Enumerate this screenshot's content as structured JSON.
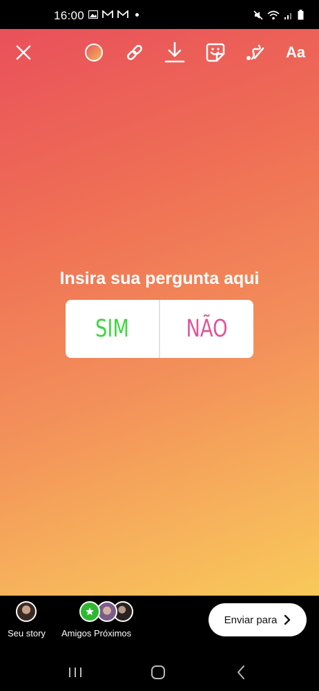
{
  "status_bar": {
    "time": "16:00"
  },
  "toolbar": {
    "close": "close-icon",
    "color": "color-circle-icon",
    "link": "link-icon",
    "download": "download-icon",
    "sticker": "sticker-icon",
    "draw": "draw-icon",
    "text_label": "Aa"
  },
  "poll": {
    "question": "Insira sua pergunta aqui",
    "options": [
      {
        "label": "SIM",
        "color": "#3fd63f"
      },
      {
        "label": "NÃO",
        "color": "#e0559a"
      }
    ]
  },
  "bottom": {
    "your_story_label": "Seu story",
    "close_friends_label": "Amigos Próximos",
    "send_label": "Enviar para"
  },
  "colors": {
    "close_friends_green": "#2eb82e"
  }
}
